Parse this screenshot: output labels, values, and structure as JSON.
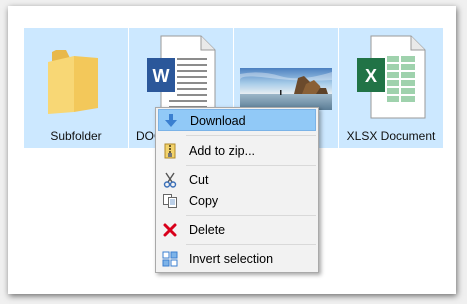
{
  "files": [
    {
      "name": "Subfolder",
      "icon": "folder-icon"
    },
    {
      "name": "DOCX",
      "icon": "word-document-icon"
    },
    {
      "name": "",
      "icon": "image-thumbnail"
    },
    {
      "name": "XLSX Document",
      "icon": "excel-document-icon"
    }
  ],
  "menu": {
    "download": "Download",
    "add_to_zip": "Add to zip...",
    "cut": "Cut",
    "copy": "Copy",
    "delete": "Delete",
    "invert_selection": "Invert selection"
  },
  "colors": {
    "selection": "#cce8ff",
    "menu_highlight": "#91c9f7",
    "word_blue": "#2b579a",
    "excel_green": "#217346",
    "folder_yellow": "#f8d775",
    "delete_red": "#d9001b"
  }
}
